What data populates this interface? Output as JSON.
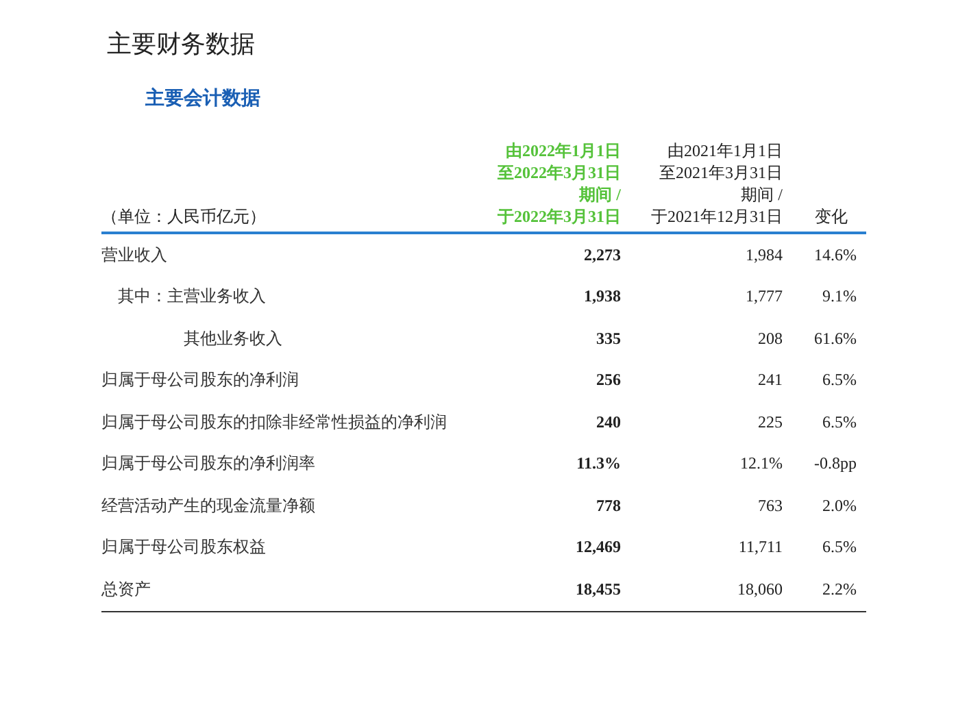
{
  "page_title": "主要财务数据",
  "section_title": "主要会计数据",
  "table": {
    "unit_label": "（单位：人民币亿元）",
    "columns": [
      {
        "lines": [
          "由2022年1月1日",
          "至2022年3月31日",
          "期间 /",
          "于2022年3月31日"
        ],
        "highlighted": true
      },
      {
        "lines": [
          "由2021年1月1日",
          "至2021年3月31日",
          "期间 /",
          "于2021年12月31日"
        ],
        "highlighted": false
      },
      {
        "lines": [
          "变化"
        ],
        "highlighted": false
      }
    ],
    "rows": [
      {
        "label": "营业收入",
        "current": "2,273",
        "prior": "1,984",
        "change": "14.6%",
        "children": [
          {
            "label": "其中：主营业务收入",
            "current": "1,938",
            "prior": "1,777",
            "change": "9.1%",
            "kind": "lead"
          },
          {
            "label": "其他业务收入",
            "current": "335",
            "prior": "208",
            "change": "61.6%",
            "kind": "continued"
          }
        ]
      },
      {
        "label": "归属于母公司股东的净利润",
        "current": "256",
        "prior": "241",
        "change": "6.5%"
      },
      {
        "label": "归属于母公司股东的扣除非经常性损益的净利润",
        "current": "240",
        "prior": "225",
        "change": "6.5%"
      },
      {
        "label": "归属于母公司股东的净利润率",
        "current": "11.3%",
        "prior": "12.1%",
        "change": "-0.8pp"
      },
      {
        "label": "经营活动产生的现金流量净额",
        "current": "778",
        "prior": "763",
        "change": "2.0%"
      },
      {
        "label": "归属于母公司股东权益",
        "current": "12,469",
        "prior": "11,711",
        "change": "6.5%"
      },
      {
        "label": "总资产",
        "current": "18,455",
        "prior": "18,060",
        "change": "2.2%"
      }
    ]
  }
}
